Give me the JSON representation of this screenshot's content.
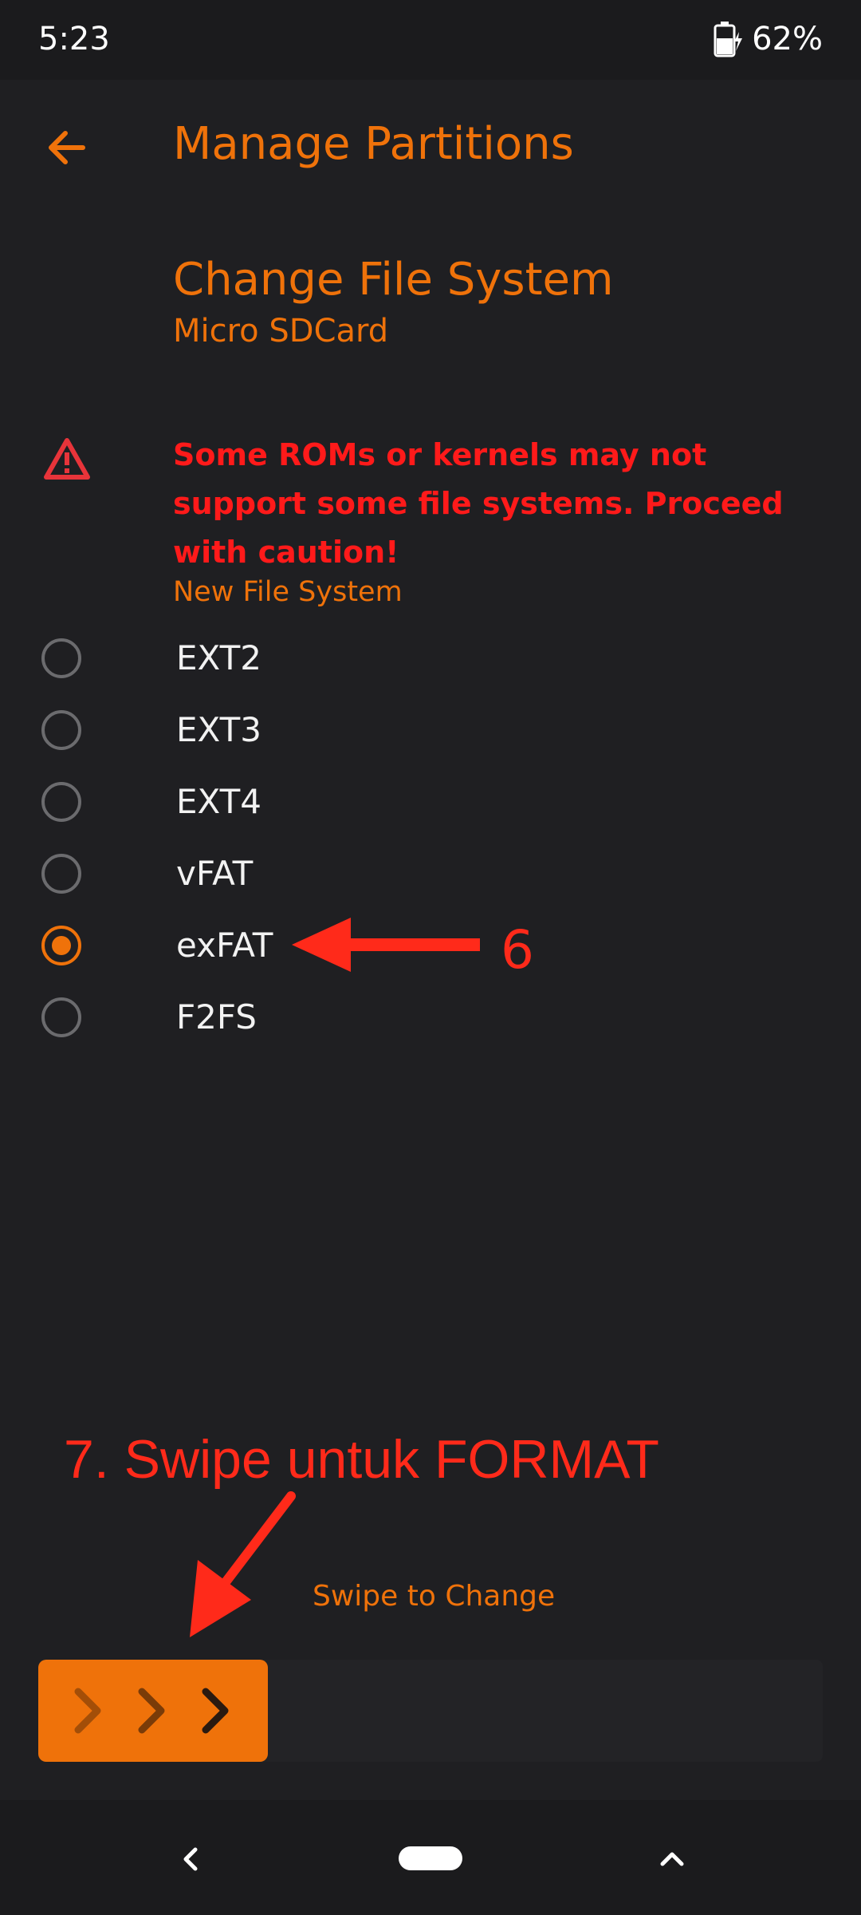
{
  "status": {
    "time": "5:23",
    "battery": "62%"
  },
  "appbar": {
    "title": "Manage Partitions"
  },
  "header": {
    "title": "Change File System",
    "subtitle": "Micro SDCard"
  },
  "warning": {
    "text": "Some ROMs or kernels may not support some file systems. Proceed with caution!"
  },
  "filesystem": {
    "label": "New File System",
    "options": [
      "EXT2",
      "EXT3",
      "EXT4",
      "vFAT",
      "exFAT",
      "F2FS"
    ],
    "selected": "exFAT"
  },
  "annotations": {
    "step6": "6",
    "step7": "7. Swipe untuk FORMAT"
  },
  "swipe": {
    "label": "Swipe to Change"
  },
  "colors": {
    "accent": "#ef720a",
    "warning": "#ff1a1a",
    "annotation": "#ff2a1a",
    "background": "#1f1f22"
  }
}
